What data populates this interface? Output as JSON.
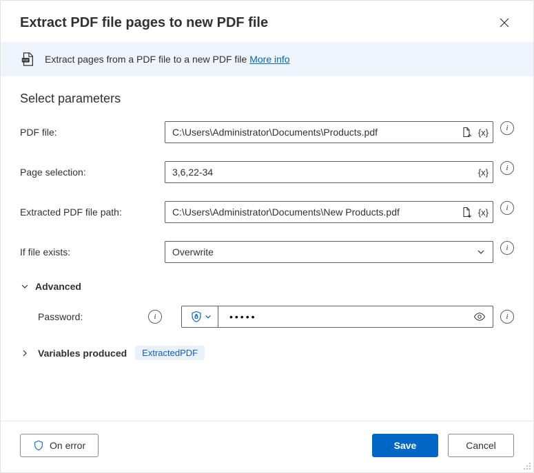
{
  "header": {
    "title": "Extract PDF file pages to new PDF file"
  },
  "banner": {
    "text": "Extract pages from a PDF file to a new PDF file ",
    "more": "More info"
  },
  "section_title": "Select parameters",
  "fields": {
    "pdf_file": {
      "label": "PDF file:",
      "value": "C:\\Users\\Administrator\\Documents\\Products.pdf",
      "var_token": "{x}"
    },
    "page_selection": {
      "label": "Page selection:",
      "value": "3,6,22-34",
      "var_token": "{x}"
    },
    "extracted_path": {
      "label": "Extracted PDF file path:",
      "value": "C:\\Users\\Administrator\\Documents\\New Products.pdf",
      "var_token": "{x}"
    },
    "if_exists": {
      "label": "If file exists:",
      "value": "Overwrite"
    }
  },
  "advanced": {
    "label": "Advanced",
    "password": {
      "label": "Password:",
      "value": "•••••"
    }
  },
  "variables_produced": {
    "label": "Variables produced",
    "pill": "ExtractedPDF"
  },
  "footer": {
    "on_error": "On error",
    "save": "Save",
    "cancel": "Cancel"
  }
}
